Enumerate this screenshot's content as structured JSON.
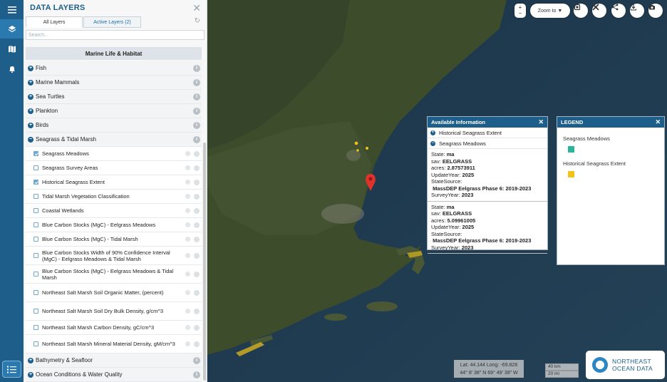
{
  "rail": {
    "menu_icon": "hamburger-icon",
    "items": [
      "layers-icon",
      "map-icon",
      "bell-icon"
    ],
    "bottom_icon": "checklist-icon"
  },
  "panel": {
    "title": "DATA LAYERS",
    "tabs": [
      "All Layers",
      "Active Layers (2)"
    ],
    "search_placeholder": "Search...",
    "section": "Marine Life & Habitat",
    "groups_top": [
      "Fish",
      "Marine Mammals",
      "Sea Turtles",
      "Plankton",
      "Birds"
    ],
    "open_group": "Seagrass & Tidal Marsh",
    "layers": [
      {
        "label": "Seagrass Meadows",
        "checked": true
      },
      {
        "label": "Seagrass Survey Areas",
        "checked": false
      },
      {
        "label": "Historical Seagrass Extent",
        "checked": true
      },
      {
        "label": "Tidal Marsh Vegetation Classification",
        "checked": false
      },
      {
        "label": "Coastal Wetlands",
        "checked": false
      },
      {
        "label": "Blue Carbon Stocks (MgC) - Eelgrass Meadows",
        "checked": false
      },
      {
        "label": "Blue Carbon Stocks (MgC) - Tidal Marsh",
        "checked": false
      },
      {
        "label": "Blue Carbon Stocks Width of 90% Confidence Interval (MgC) - Eelgrass Meadows & Tidal Marsh",
        "checked": false
      },
      {
        "label": "Blue Carbon Stocks (MgC) - Eelgrass Meadows & Tidal Marsh",
        "checked": false
      },
      {
        "label": "Northeast Salt Marsh Soil Organic Matter, (percent)",
        "checked": false
      },
      {
        "label": "Northeast Salt Marsh Soil Dry Bulk Density, g/cm^3",
        "checked": false
      },
      {
        "label": "Northeast Salt Marsh Carbon Density, gC/cm^3",
        "checked": false
      },
      {
        "label": "Northeast Salt Marsh Mineral Material Density, gM/cm^3",
        "checked": false
      }
    ],
    "groups_bottom": [
      "Bathymetry & Seafloor",
      "Ocean Conditions & Water Quality"
    ]
  },
  "toolbar": {
    "zoom_label": "Zoom to ▼",
    "small_btn": [
      "+",
      "−"
    ],
    "icons": [
      "layer-stack-icon",
      "tools-icon",
      "share-icon",
      "download-icon",
      "camera-icon"
    ]
  },
  "available": {
    "title": "Available Information",
    "rows": [
      "Historical Seagrass Extent",
      "Seagrass Meadows"
    ],
    "records": [
      {
        "state_label": "State:",
        "state": "ma",
        "sav_label": "sav:",
        "sav": "EELGRASS",
        "acres_label": "acres:",
        "acres": "2.87573911",
        "year_label": "UpdateYear:",
        "year": "2025",
        "source_label": "StateSource:",
        "source": "MassDEP Eelgrass Phase 6: 2019-2023",
        "survey_label": "SurveyYear:",
        "survey": "2023"
      },
      {
        "state_label": "State:",
        "state": "ma",
        "sav_label": "sav:",
        "sav": "EELGRASS",
        "acres_label": "acres:",
        "acres": "5.09961005",
        "year_label": "UpdateYear:",
        "year": "2025",
        "source_label": "StateSource:",
        "source": "MassDEP Eelgrass Phase 6: 2019-2023",
        "survey_label": "SurveyYear:",
        "survey": "2023"
      }
    ]
  },
  "legend": {
    "title": "LEGEND",
    "items": [
      {
        "label": "Seagrass Meadows",
        "color": "#2bb59a"
      },
      {
        "label": "Historical Seagrass Extent",
        "color": "#f2c317"
      }
    ]
  },
  "map": {
    "lat_long": "Lat: 44.144 Long: -69.828",
    "dms": "44° 8' 38\" N 69° 49' 39\" W",
    "scale_km": "40 km",
    "scale_mi": "20 mi",
    "logo_line1": "NORTHEAST",
    "logo_line2": "OCEAN DATA",
    "marker_color": "#e0322d"
  }
}
